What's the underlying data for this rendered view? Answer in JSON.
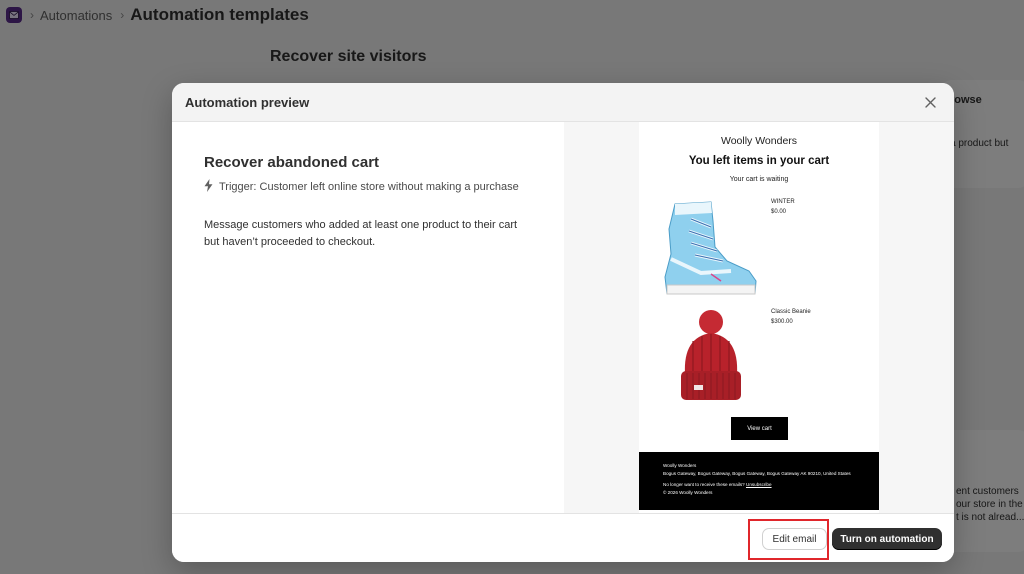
{
  "breadcrumb": {
    "parent": "Automations",
    "separator": "›",
    "title": "Automation templates"
  },
  "background": {
    "section_title": "Recover site visitors",
    "card_browse": {
      "title_fragment": "rowse",
      "text_lines": [
        "a product but"
      ]
    },
    "card_customers": {
      "text_lines": [
        "ent customers",
        "our store in the",
        "t is not alread..."
      ]
    }
  },
  "modal": {
    "title": "Automation preview",
    "automation_name": "Recover abandoned cart",
    "trigger": "Trigger: Customer left online store without making a purchase",
    "description": "Message customers who added at least one product to their cart but haven’t proceeded to checkout.",
    "email": {
      "shop_name": "Woolly Wonders",
      "headline": "You left items in your cart",
      "subheading": "Your cart is waiting",
      "products": [
        {
          "name": "WINTER",
          "price": "$0.00"
        },
        {
          "name": "Classic Beanie",
          "price": "$300.00"
        }
      ],
      "cta": "View cart",
      "footer": {
        "company": "Woolly Wonders",
        "address": "Bogus Gateway, Bogus Gateway, Bogus Gateway, Bogus Gateway AK 90210, United States",
        "unsubscribe_prefix": "No longer want to receive these emails?",
        "unsubscribe_link": "Unsubscribe",
        "copyright": "© 2026 Woolly Wonders"
      }
    },
    "buttons": {
      "edit_email": "Edit email",
      "turn_on": "Turn on automation"
    }
  },
  "colors": {
    "overlay": "#000000",
    "primary_button": "#303030",
    "highlight": "#e0262b",
    "beanie": "#b8222b",
    "boot": "#7cc3e6"
  },
  "icons": {
    "app": "mail-icon",
    "trigger": "lightning-icon",
    "close": "close-icon"
  }
}
